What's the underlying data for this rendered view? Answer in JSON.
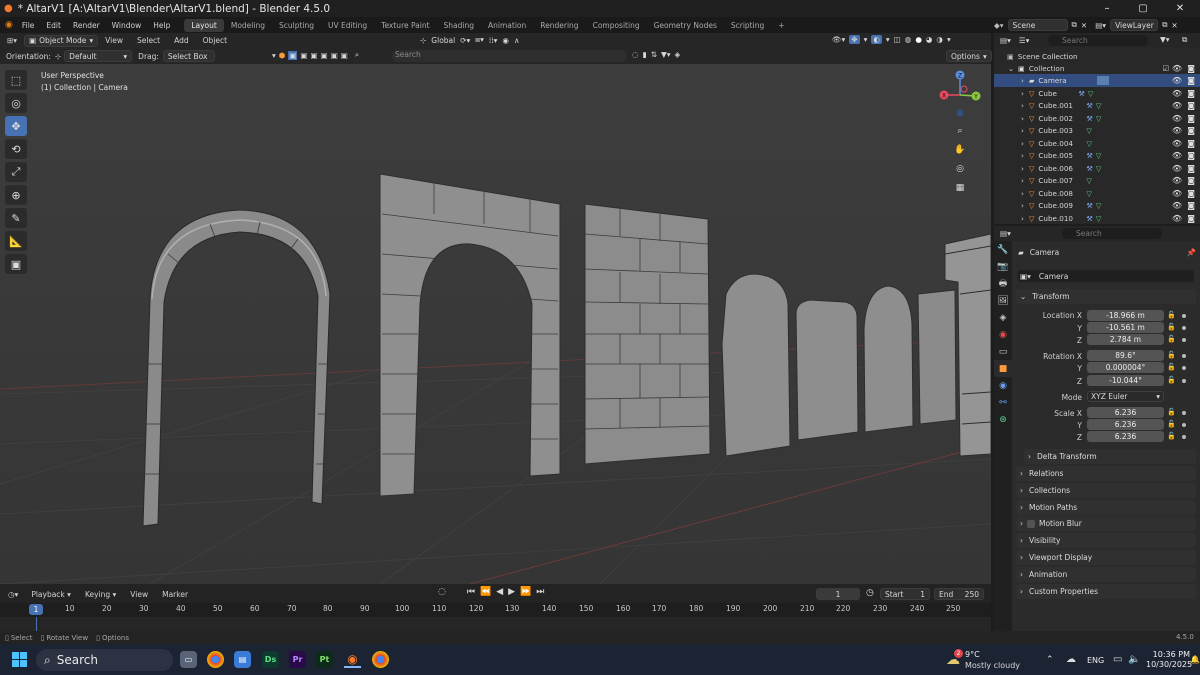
{
  "titlebar": {
    "title": "* AltarV1 [A:\\AltarV1\\Blender\\AltarV1.blend] - Blender 4.5.0",
    "min": "–",
    "max": "▢",
    "close": "✕"
  },
  "menus": [
    "File",
    "Edit",
    "Render",
    "Window",
    "Help"
  ],
  "workspaces": [
    "Layout",
    "Modeling",
    "Sculpting",
    "UV Editing",
    "Texture Paint",
    "Shading",
    "Animation",
    "Rendering",
    "Compositing",
    "Geometry Nodes",
    "Scripting"
  ],
  "add_workspace": "+",
  "scene": {
    "scene_name": "Scene",
    "view_layer": "ViewLayer"
  },
  "viewport_header": {
    "mode": "Object Mode",
    "menus": [
      "View",
      "Select",
      "Add",
      "Object"
    ],
    "transform_orientation": "Global",
    "options": "Options"
  },
  "viewport_header2": {
    "orientation_label": "Orientation:",
    "orientation_value": "Default",
    "drag_label": "Drag:",
    "drag_value": "Select Box",
    "search_placeholder": "Search"
  },
  "viewport_info": {
    "line1": "User Perspective",
    "line2": "(1) Collection | Camera"
  },
  "gizmo": {
    "x": "X",
    "y": "Y",
    "z": "Z"
  },
  "timeline": {
    "menus": [
      "Playback",
      "Keying",
      "View",
      "Marker"
    ],
    "current_frame": "1",
    "start_label": "Start",
    "start": "1",
    "end_label": "End",
    "end": "250",
    "ticks": [
      "1",
      "10",
      "20",
      "30",
      "40",
      "50",
      "60",
      "70",
      "80",
      "90",
      "100",
      "110",
      "120",
      "130",
      "140",
      "150",
      "160",
      "170",
      "180",
      "190",
      "200",
      "210",
      "220",
      "230",
      "240",
      "250"
    ]
  },
  "statusbar": {
    "select": "Select",
    "rotate": "Rotate View",
    "options": "Options",
    "version": "4.5.0"
  },
  "outliner": {
    "search_placeholder": "Search",
    "root": "Scene Collection",
    "collection": "Collection",
    "items": [
      "Camera",
      "Cube",
      "Cube.001",
      "Cube.002",
      "Cube.003",
      "Cube.004",
      "Cube.005",
      "Cube.006",
      "Cube.007",
      "Cube.008",
      "Cube.009",
      "Cube.010"
    ]
  },
  "properties": {
    "search_placeholder": "Search",
    "object_name": "Camera",
    "object_field": "Camera",
    "transform_title": "Transform",
    "location_label": "Location X",
    "rotation_label": "Rotation X",
    "mode_label": "Mode",
    "scale_label": "Scale X",
    "y": "Y",
    "z": "Z",
    "location": [
      "-18.966 m",
      "-10.561 m",
      "2.784 m"
    ],
    "rotation": [
      "89.6°",
      "0.000004°",
      "-10.044°"
    ],
    "mode": "XYZ Euler",
    "scale": [
      "6.236",
      "6.236",
      "6.236"
    ],
    "delta": "Delta Transform",
    "panels": [
      "Relations",
      "Collections",
      "Motion Paths",
      "Motion Blur",
      "Visibility",
      "Viewport Display",
      "Animation",
      "Custom Properties"
    ]
  },
  "taskbar": {
    "search": "Search",
    "weather_temp": "9°C",
    "weather_desc": "Mostly cloudy",
    "weather_badge": "2",
    "lang": "ENG",
    "time": "10:36 PM",
    "date": "10/30/2025",
    "app_labels": {
      "davinci": "Ds",
      "premiere": "Pr",
      "painter": "Pt"
    }
  }
}
